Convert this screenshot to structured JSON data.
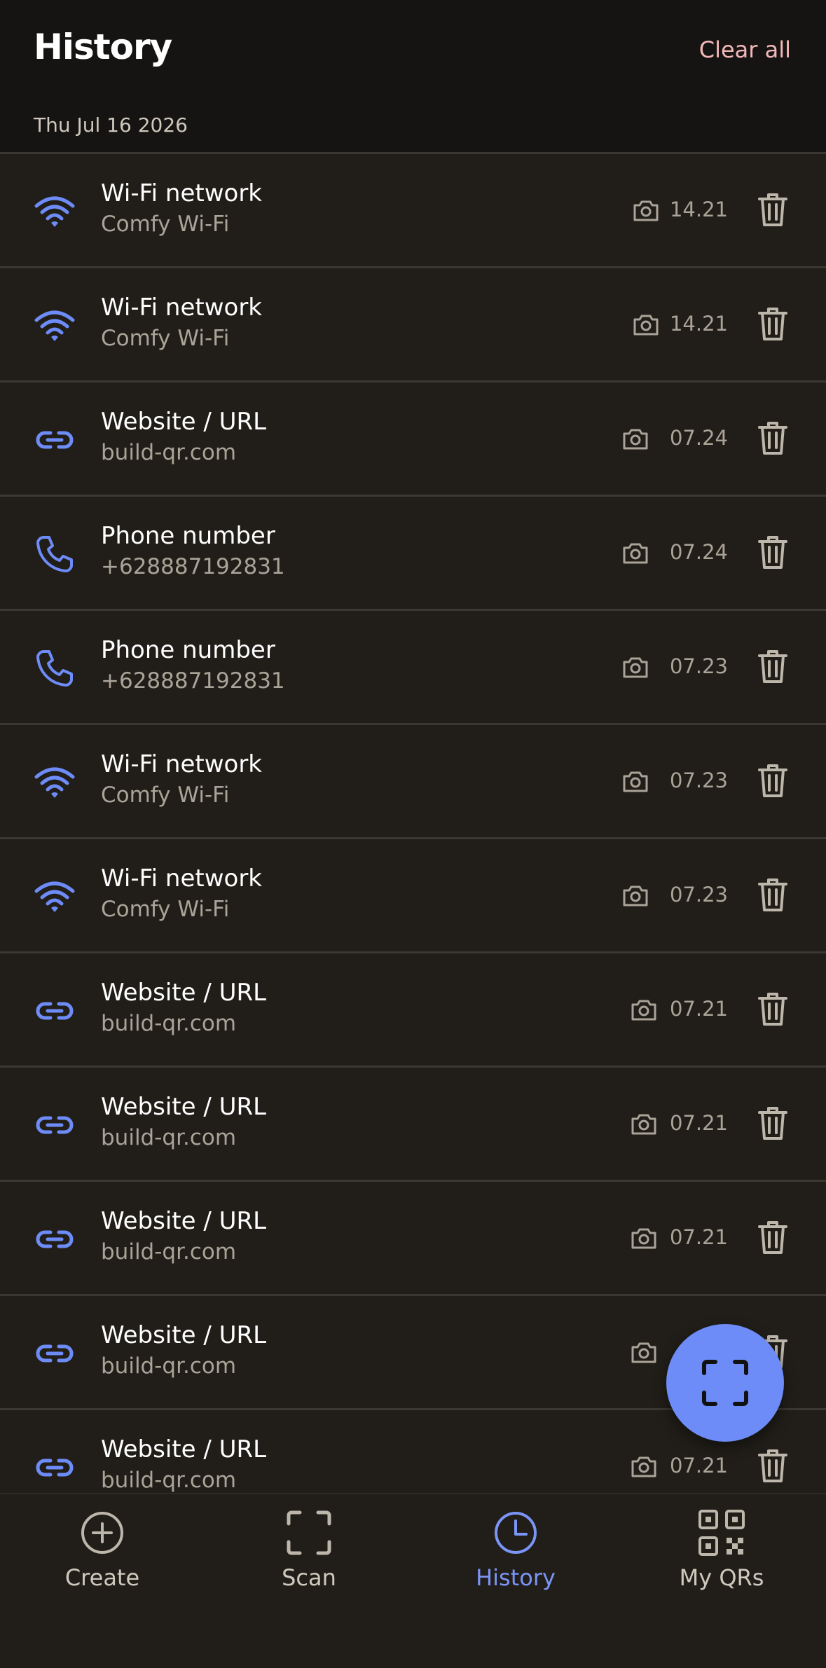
{
  "header": {
    "title": "History",
    "clear_all_label": "Clear all",
    "date_label": "Thu Jul 16 2026"
  },
  "colors": {
    "accent": "#6e8cf8",
    "background": "#211e19",
    "header_background": "#161412",
    "clear_all": "#f2b8b8"
  },
  "items": [
    {
      "type_icon": "wifi-icon",
      "title": "Wi-Fi network",
      "subtitle": "Comfy Wi-Fi",
      "time": "14.21"
    },
    {
      "type_icon": "wifi-icon",
      "title": "Wi-Fi network",
      "subtitle": "Comfy Wi-Fi",
      "time": "14.21"
    },
    {
      "type_icon": "link-icon",
      "title": "Website / URL",
      "subtitle": "build-qr.com",
      "time": "07.24"
    },
    {
      "type_icon": "phone-icon",
      "title": "Phone number",
      "subtitle": "+628887192831",
      "time": "07.24"
    },
    {
      "type_icon": "phone-icon",
      "title": "Phone number",
      "subtitle": "+628887192831",
      "time": "07.23"
    },
    {
      "type_icon": "wifi-icon",
      "title": "Wi-Fi network",
      "subtitle": "Comfy Wi-Fi",
      "time": "07.23"
    },
    {
      "type_icon": "wifi-icon",
      "title": "Wi-Fi network",
      "subtitle": "Comfy Wi-Fi",
      "time": "07.23"
    },
    {
      "type_icon": "link-icon",
      "title": "Website / URL",
      "subtitle": "build-qr.com",
      "time": "07.21"
    },
    {
      "type_icon": "link-icon",
      "title": "Website / URL",
      "subtitle": "build-qr.com",
      "time": "07.21"
    },
    {
      "type_icon": "link-icon",
      "title": "Website / URL",
      "subtitle": "build-qr.com",
      "time": "07.21"
    },
    {
      "type_icon": "link-icon",
      "title": "Website / URL",
      "subtitle": "build-qr.com",
      "time": ""
    },
    {
      "type_icon": "link-icon",
      "title": "Website / URL",
      "subtitle": "build-qr.com",
      "time": "07.21"
    }
  ],
  "fab": {
    "icon": "scan-frame-icon"
  },
  "nav": [
    {
      "label": "Create",
      "icon": "plus-circle-icon",
      "active": false
    },
    {
      "label": "Scan",
      "icon": "scan-frame-icon",
      "active": false
    },
    {
      "label": "History",
      "icon": "clock-icon",
      "active": true
    },
    {
      "label": "My QRs",
      "icon": "qr-code-icon",
      "active": false
    }
  ]
}
